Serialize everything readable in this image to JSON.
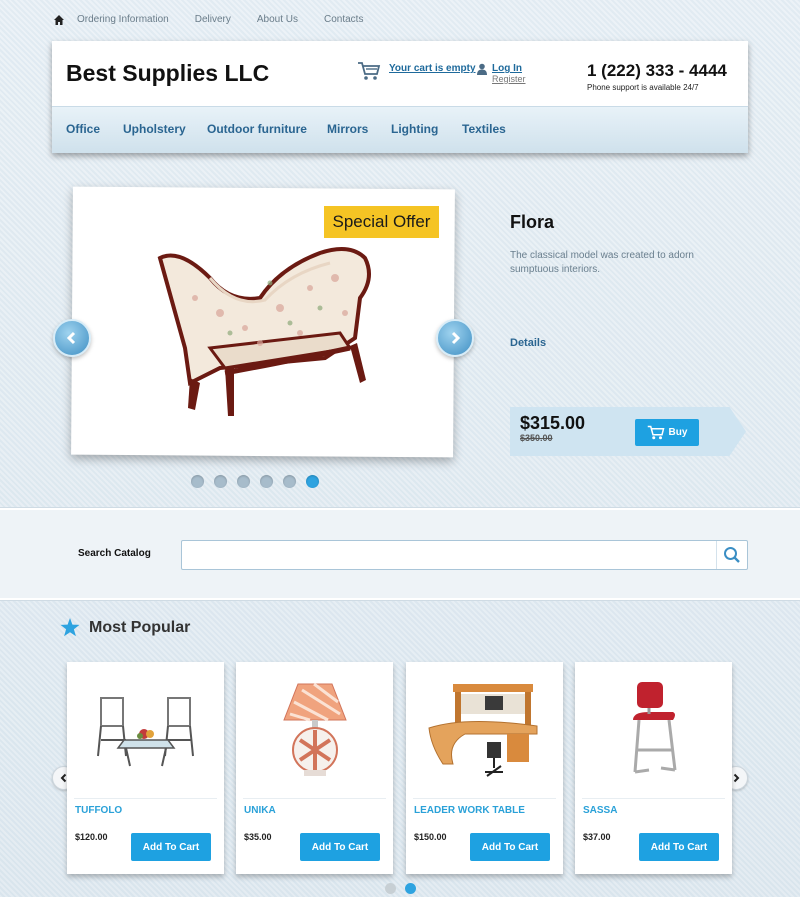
{
  "topnav": {
    "home_icon": "home-icon",
    "links": [
      "Ordering Information",
      "Delivery",
      "About Us",
      "Contacts"
    ]
  },
  "header": {
    "brand": "Best Supplies LLC",
    "cart_text": "Your cart is empty",
    "login": "Log In",
    "register": "Register",
    "phone": "1 (222) 333 - 4444",
    "phone_note": "Phone support is available 24/7"
  },
  "categories": [
    "Office",
    "Upholstery",
    "Outdoor furniture",
    "Mirrors",
    "Lighting",
    "Textiles"
  ],
  "slider": {
    "badge": "Special Offer",
    "title": "Flora",
    "description": "The classical model was created to adorn sumptuous interiors.",
    "details": "Details",
    "price": "$315.00",
    "old_price": "$350.00",
    "buy": "Buy",
    "slide_count": 6,
    "active_slide": 6
  },
  "search": {
    "label": "Search Catalog",
    "placeholder": ""
  },
  "popular": {
    "title": "Most Popular",
    "products": [
      {
        "name": "TUFFOLO",
        "price": "$120.00",
        "button": "Add To Cart"
      },
      {
        "name": "UNIKA",
        "price": "$35.00",
        "button": "Add To Cart"
      },
      {
        "name": "LEADER WORK TABLE",
        "price": "$150.00",
        "button": "Add To Cart"
      },
      {
        "name": "SASSA",
        "price": "$37.00",
        "button": "Add To Cart"
      }
    ],
    "page_count": 2,
    "active_page": 2
  },
  "colors": {
    "accent": "#1ea1e1",
    "link": "#2a6591",
    "badge": "#f5c424"
  }
}
